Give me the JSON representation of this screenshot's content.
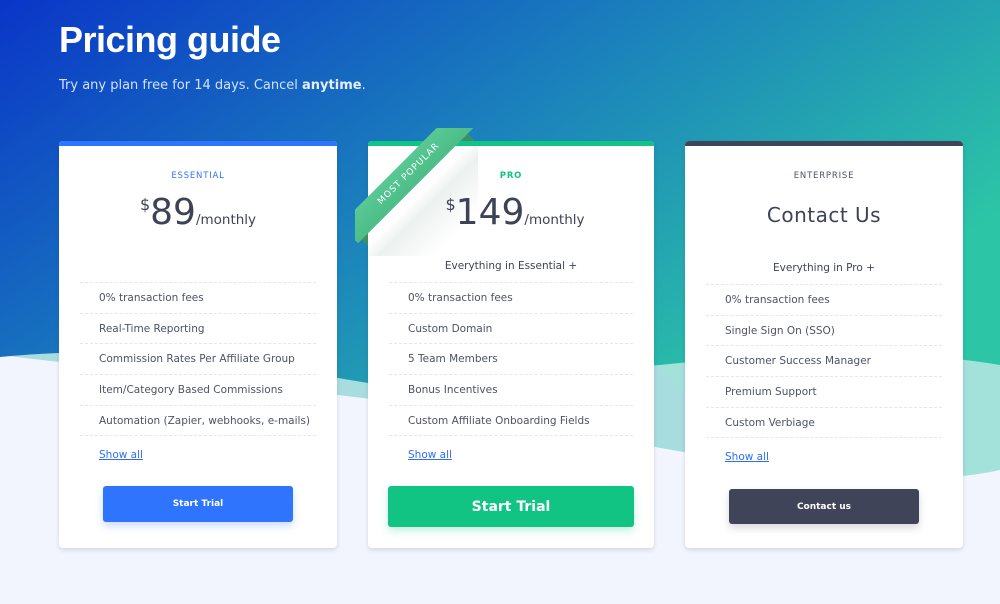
{
  "hero": {
    "title": "Pricing guide",
    "subtitle_prefix": "Try any plan free for 14 days. Cancel ",
    "subtitle_bold": "anytime",
    "subtitle_suffix": "."
  },
  "colors": {
    "essential_accent": "#2f74fc",
    "pro_accent": "#12c483",
    "enterprise_accent": "#404458",
    "link": "#2d6ef5",
    "hero_gradient_start": "#0a35c8",
    "hero_gradient_end": "#2cc0a8",
    "page_bg": "#f2f5fd"
  },
  "plans": [
    {
      "tier": "ESSENTIAL",
      "currency": "$",
      "amount": "89",
      "period": "/monthly",
      "features": [
        "0% transaction fees",
        "Real-Time Reporting",
        "Commission Rates Per Affiliate Group",
        "Item/Category Based Commissions",
        "Automation (Zapier, webhooks, e-mails)"
      ],
      "show_all": "Show all",
      "cta": "Start Trial"
    },
    {
      "tier": "PRO",
      "badge": "MOST POPULAR",
      "currency": "$",
      "amount": "149",
      "period": "/monthly",
      "includes": "Everything in Essential +",
      "features": [
        "0% transaction fees",
        "Custom Domain",
        "5 Team Members",
        "Bonus Incentives",
        "Custom Affiliate Onboarding Fields"
      ],
      "show_all": "Show all",
      "cta": "Start Trial"
    },
    {
      "tier": "ENTERPRISE",
      "title": "Contact Us",
      "includes": "Everything in Pro +",
      "features": [
        "0% transaction fees",
        "Single Sign On (SSO)",
        "Customer Success Manager",
        "Premium Support",
        "Custom Verbiage"
      ],
      "show_all": "Show all",
      "cta": "Contact us"
    }
  ]
}
